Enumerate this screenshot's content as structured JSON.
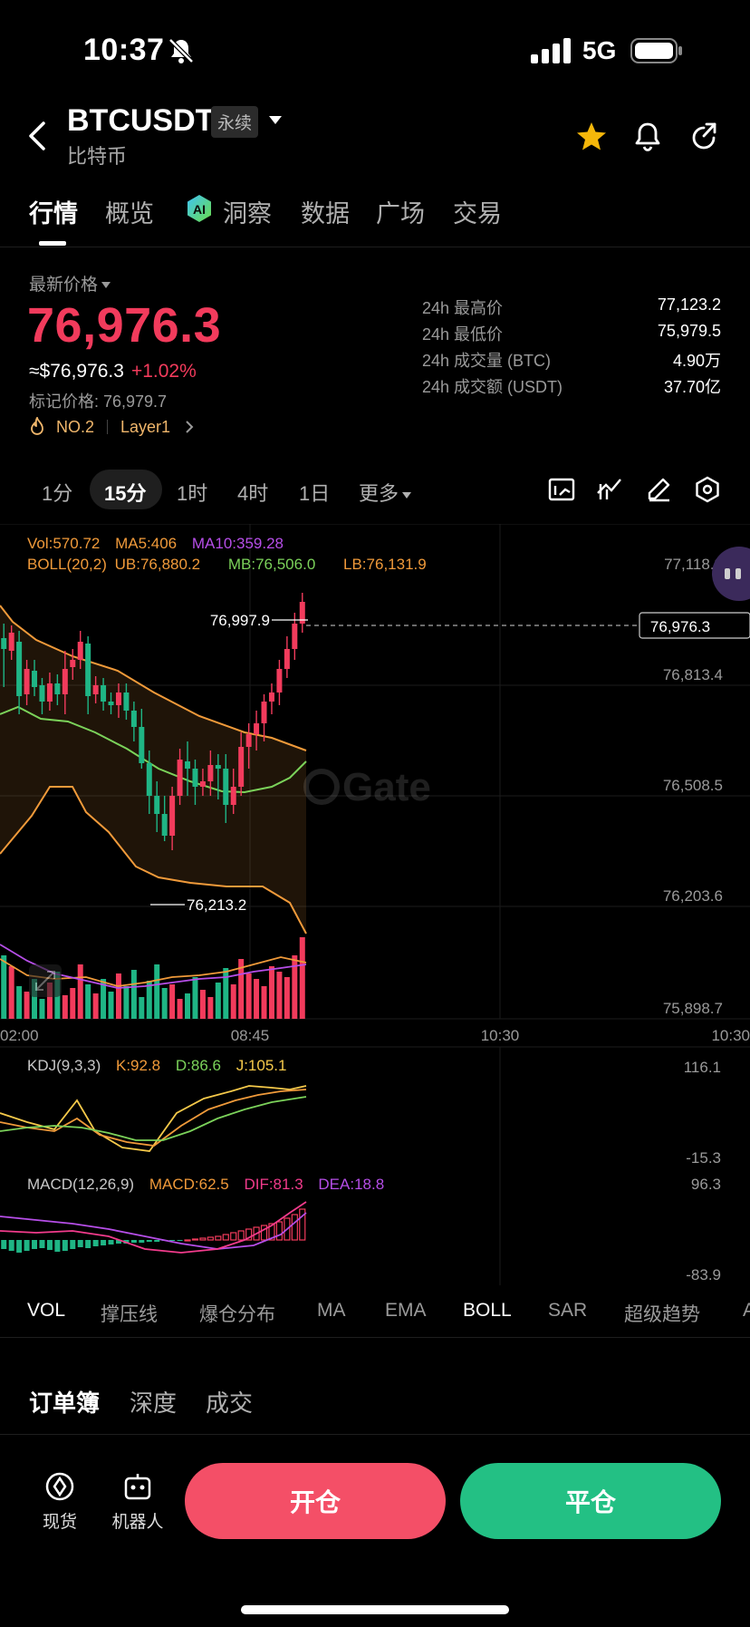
{
  "status_bar": {
    "time": "10:37",
    "network": "5G"
  },
  "header": {
    "symbol": "BTCUSDT",
    "contract_badge": "永续",
    "coin_name": "比特币"
  },
  "main_tabs": [
    "行情",
    "概览",
    "洞察",
    "数据",
    "广场",
    "交易"
  ],
  "price_block": {
    "latest_label": "最新价格",
    "last_price": "76,976.3",
    "usd_price": "≈$76,976.3",
    "change_pct": "+1.02%",
    "mark_price": "标记价格: 76,979.7",
    "rank": "NO.2",
    "sector": "Layer1"
  },
  "stats": [
    {
      "label": "24h 最高价",
      "value": "77,123.2"
    },
    {
      "label": "24h 最低价",
      "value": "75,979.5"
    },
    {
      "label": "24h 成交量 (BTC)",
      "value": "4.90万"
    },
    {
      "label": "24h 成交额 (USDT)",
      "value": "37.70亿"
    }
  ],
  "timeframes": [
    "1分",
    "15分",
    "1时",
    "4时",
    "1日",
    "更多"
  ],
  "active_timeframe": "15分",
  "chart_legend": {
    "vol": "Vol:570.72",
    "ma5": "MA5:406",
    "ma10": "MA10:359.28",
    "boll_name": "BOLL(20,2)",
    "boll_ub": "UB:76,880.2",
    "boll_mb": "MB:76,506.0",
    "boll_lb": "LB:76,131.9",
    "kdj_name": "KDJ(9,3,3)",
    "kdj_k": "K:92.8",
    "kdj_d": "D:86.6",
    "kdj_j": "J:105.1",
    "macd_name": "MACD(12,26,9)",
    "macd_val": "MACD:62.5",
    "macd_dif": "DIF:81.3",
    "macd_dea": "DEA:18.8"
  },
  "chart_data": {
    "type": "candlestick",
    "price_axis_ticks": [
      "77,118.3",
      "76,813.4",
      "76,508.5",
      "76,203.6",
      "75,898.7"
    ],
    "time_axis_ticks": [
      "02:00",
      "08:45",
      "10:30",
      "10:30"
    ],
    "current_price_tag": "76,976.3",
    "high_marker": "76,997.9",
    "low_marker": "76,213.2",
    "kdj_axis": [
      "116.1",
      "-15.3"
    ],
    "macd_axis": [
      "96.3",
      "-83.9"
    ],
    "colors": {
      "up": "#f23b5c",
      "down": "#1fb585",
      "boll_band": "#f09a3a",
      "mb": "#7bd25a",
      "ma10": "#b64ee8"
    }
  },
  "indicator_tabs": [
    "VOL",
    "撑压线",
    "爆仓分布",
    "MA",
    "EMA",
    "BOLL",
    "SAR",
    "超级趋势",
    "A"
  ],
  "active_indicators": [
    "VOL",
    "BOLL"
  ],
  "orderbook_tabs": [
    "订单簿",
    "深度",
    "成交"
  ],
  "bottom_bar": {
    "spot_label": "现货",
    "bot_label": "机器人",
    "open_label": "开仓",
    "close_label": "平仓"
  },
  "watermark": "Gate"
}
